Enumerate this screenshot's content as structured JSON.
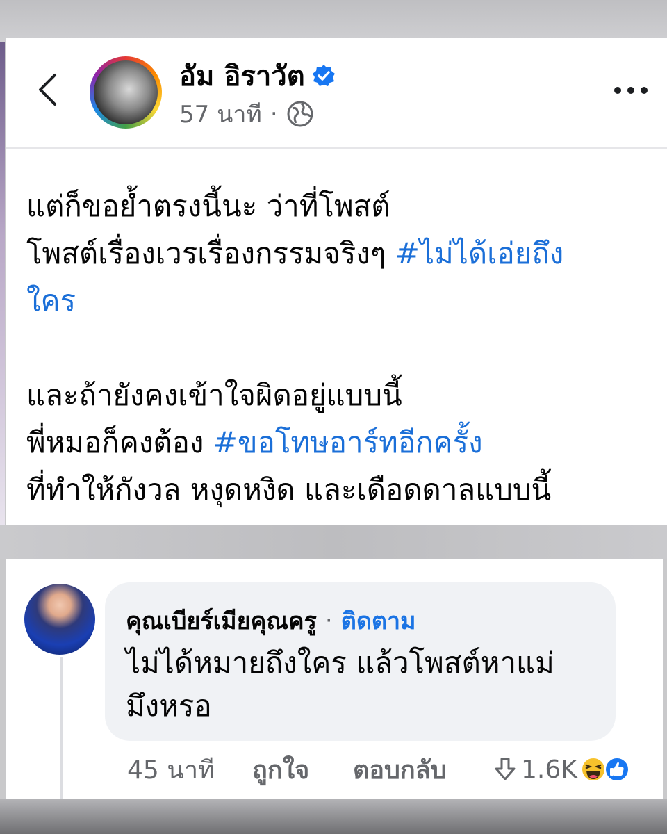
{
  "post": {
    "author": "อัม อิราวัต",
    "time": "57 นาที",
    "meta_separator": "·",
    "lines": [
      {
        "text": "แต่ก็ขอย้ำตรงนี้นะ ว่าที่โพสต์",
        "tag": ""
      },
      {
        "text": "โพสต์เรื่องเวรเรื่องกรรมจริงๆ ",
        "tag": "#ไม่ได้เอ่ยถึง"
      },
      {
        "text": "",
        "tag": "ใคร"
      },
      {
        "text": "และถ้ายังคงเข้าใจผิดอยู่แบบนี้",
        "tag": ""
      },
      {
        "text": "พี่หมอก็คงต้อง ",
        "tag": "#ขอโทษอาร์ทอีกครั้ง"
      },
      {
        "text": "ที่ทำให้กังวล หงุดหงิด และเดือดดาลแบบนี้",
        "tag": ""
      }
    ]
  },
  "comment": {
    "author": "คุณเบียร์เมียคุณครู",
    "separator": "·",
    "follow_label": "ติดตาม",
    "text_line1": "ไม่ได้หมายถึงใคร แล้วโพสต์หาแม่",
    "text_line2": "มึงหรอ",
    "time": "45 นาที",
    "like_label": "ถูกใจ",
    "reply_label": "ตอบกลับ",
    "reaction_count": "1.6K"
  },
  "icons": [
    "back-chevron-icon",
    "verified-badge-icon",
    "globe-icon",
    "more-options-icon",
    "downvote-icon",
    "haha-reaction-icon",
    "like-reaction-icon"
  ],
  "colors": {
    "hashtag": "#1b6fd8",
    "verified": "#1877f2",
    "bubble": "#f0f2f5",
    "secondary_text": "#65676b"
  }
}
